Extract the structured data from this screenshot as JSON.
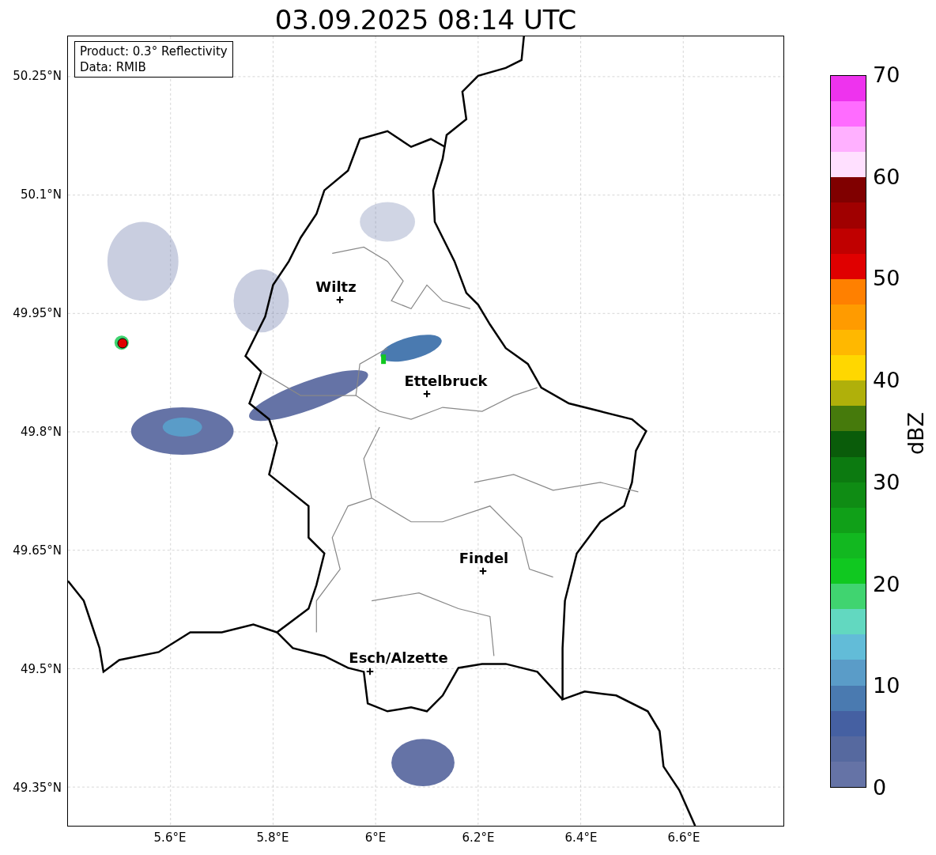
{
  "title": "03.09.2025 08:14 UTC",
  "info_box": [
    "Product: 0.3° Reflectivity",
    "Data: RMIB"
  ],
  "y_ticks": [
    "50.25°N",
    "50.1°N",
    "49.95°N",
    "49.8°N",
    "49.65°N",
    "49.5°N",
    "49.35°N"
  ],
  "x_ticks": [
    "5.6°E",
    "5.8°E",
    "6°E",
    "6.2°E",
    "6.4°E",
    "6.6°E"
  ],
  "cities": [
    {
      "name": "Wiltz"
    },
    {
      "name": "Ettelbruck"
    },
    {
      "name": "Findel"
    },
    {
      "name": "Esch/Alzette"
    }
  ],
  "colorbar": {
    "label": "dBZ",
    "ticks": [
      "70",
      "60",
      "50",
      "40",
      "30",
      "20",
      "10",
      "0"
    ],
    "bins": [
      {
        "color": "#6573a6"
      },
      {
        "color": "#56699f"
      },
      {
        "color": "#4560a2"
      },
      {
        "color": "#4a7ab0"
      },
      {
        "color": "#5a9cc8"
      },
      {
        "color": "#62bcd8"
      },
      {
        "color": "#62d8c0"
      },
      {
        "color": "#40d470"
      },
      {
        "color": "#10c820"
      },
      {
        "color": "#12b820"
      },
      {
        "color": "#10a018"
      },
      {
        "color": "#0f8c14"
      },
      {
        "color": "#0c7a10"
      },
      {
        "color": "#0a5c0a"
      },
      {
        "color": "#467a0c"
      },
      {
        "color": "#b0b00a"
      },
      {
        "color": "#ffd700"
      },
      {
        "color": "#ffb800"
      },
      {
        "color": "#ff9b00"
      },
      {
        "color": "#ff8000"
      },
      {
        "color": "#e00000"
      },
      {
        "color": "#c00000"
      },
      {
        "color": "#a00000"
      },
      {
        "color": "#800000"
      },
      {
        "color": "#ffe0ff"
      },
      {
        "color": "#ffb0ff"
      },
      {
        "color": "#ff6cff"
      },
      {
        "color": "#ee33ee"
      }
    ]
  }
}
